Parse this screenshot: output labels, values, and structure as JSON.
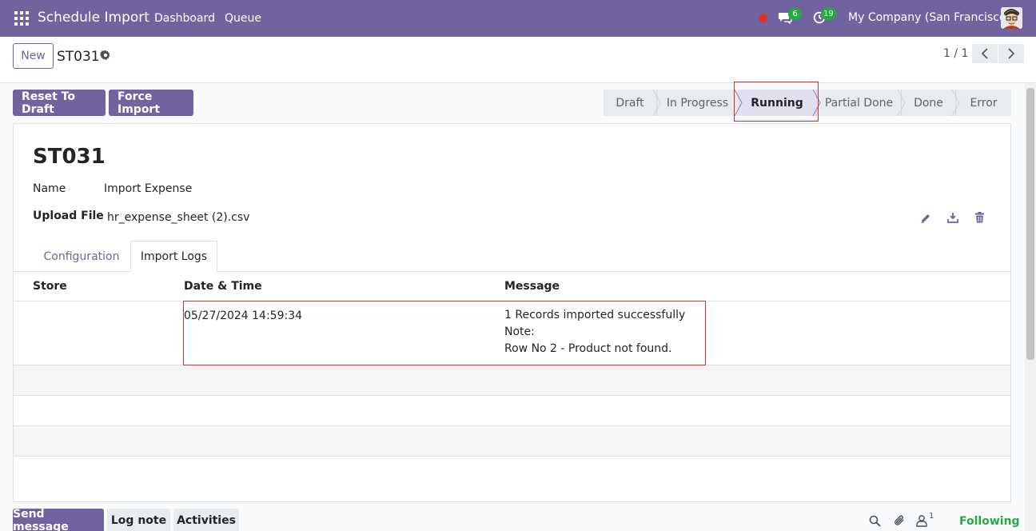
{
  "navbar": {
    "app_title": "Schedule Import",
    "menu": [
      "Dashboard",
      "Queue"
    ],
    "messages_count": "6",
    "activities_count": "19",
    "company": "My Company (San Francisco)",
    "color": "#71639e"
  },
  "control_panel": {
    "new_label": "New",
    "record_name": "ST031",
    "pager": "1 / 1"
  },
  "actions": {
    "reset_to_draft": "Reset To Draft",
    "force_import": "Force Import"
  },
  "statusbar": {
    "stages": [
      "Draft",
      "In Progress",
      "Running",
      "Partial Done",
      "Done",
      "Error"
    ],
    "active": "Running"
  },
  "form": {
    "title": "ST031",
    "name_label": "Name",
    "name_value": "Import Expense",
    "upload_label": "Upload File",
    "upload_value": "hr_expense_sheet (2).csv"
  },
  "tabs": [
    "Configuration",
    "Import Logs"
  ],
  "active_tab": "Import Logs",
  "logs_table": {
    "columns": [
      "Store",
      "Date & Time",
      "Message"
    ],
    "rows": [
      {
        "store": "",
        "datetime": "05/27/2024 14:59:34",
        "message": [
          "1 Records imported successfully",
          "Note:",
          "Row No 2  - Product not found."
        ]
      }
    ]
  },
  "chatter": {
    "send_message": "Send message",
    "log_note": "Log note",
    "activities": "Activities",
    "followers_count": "1",
    "following": "Following"
  }
}
